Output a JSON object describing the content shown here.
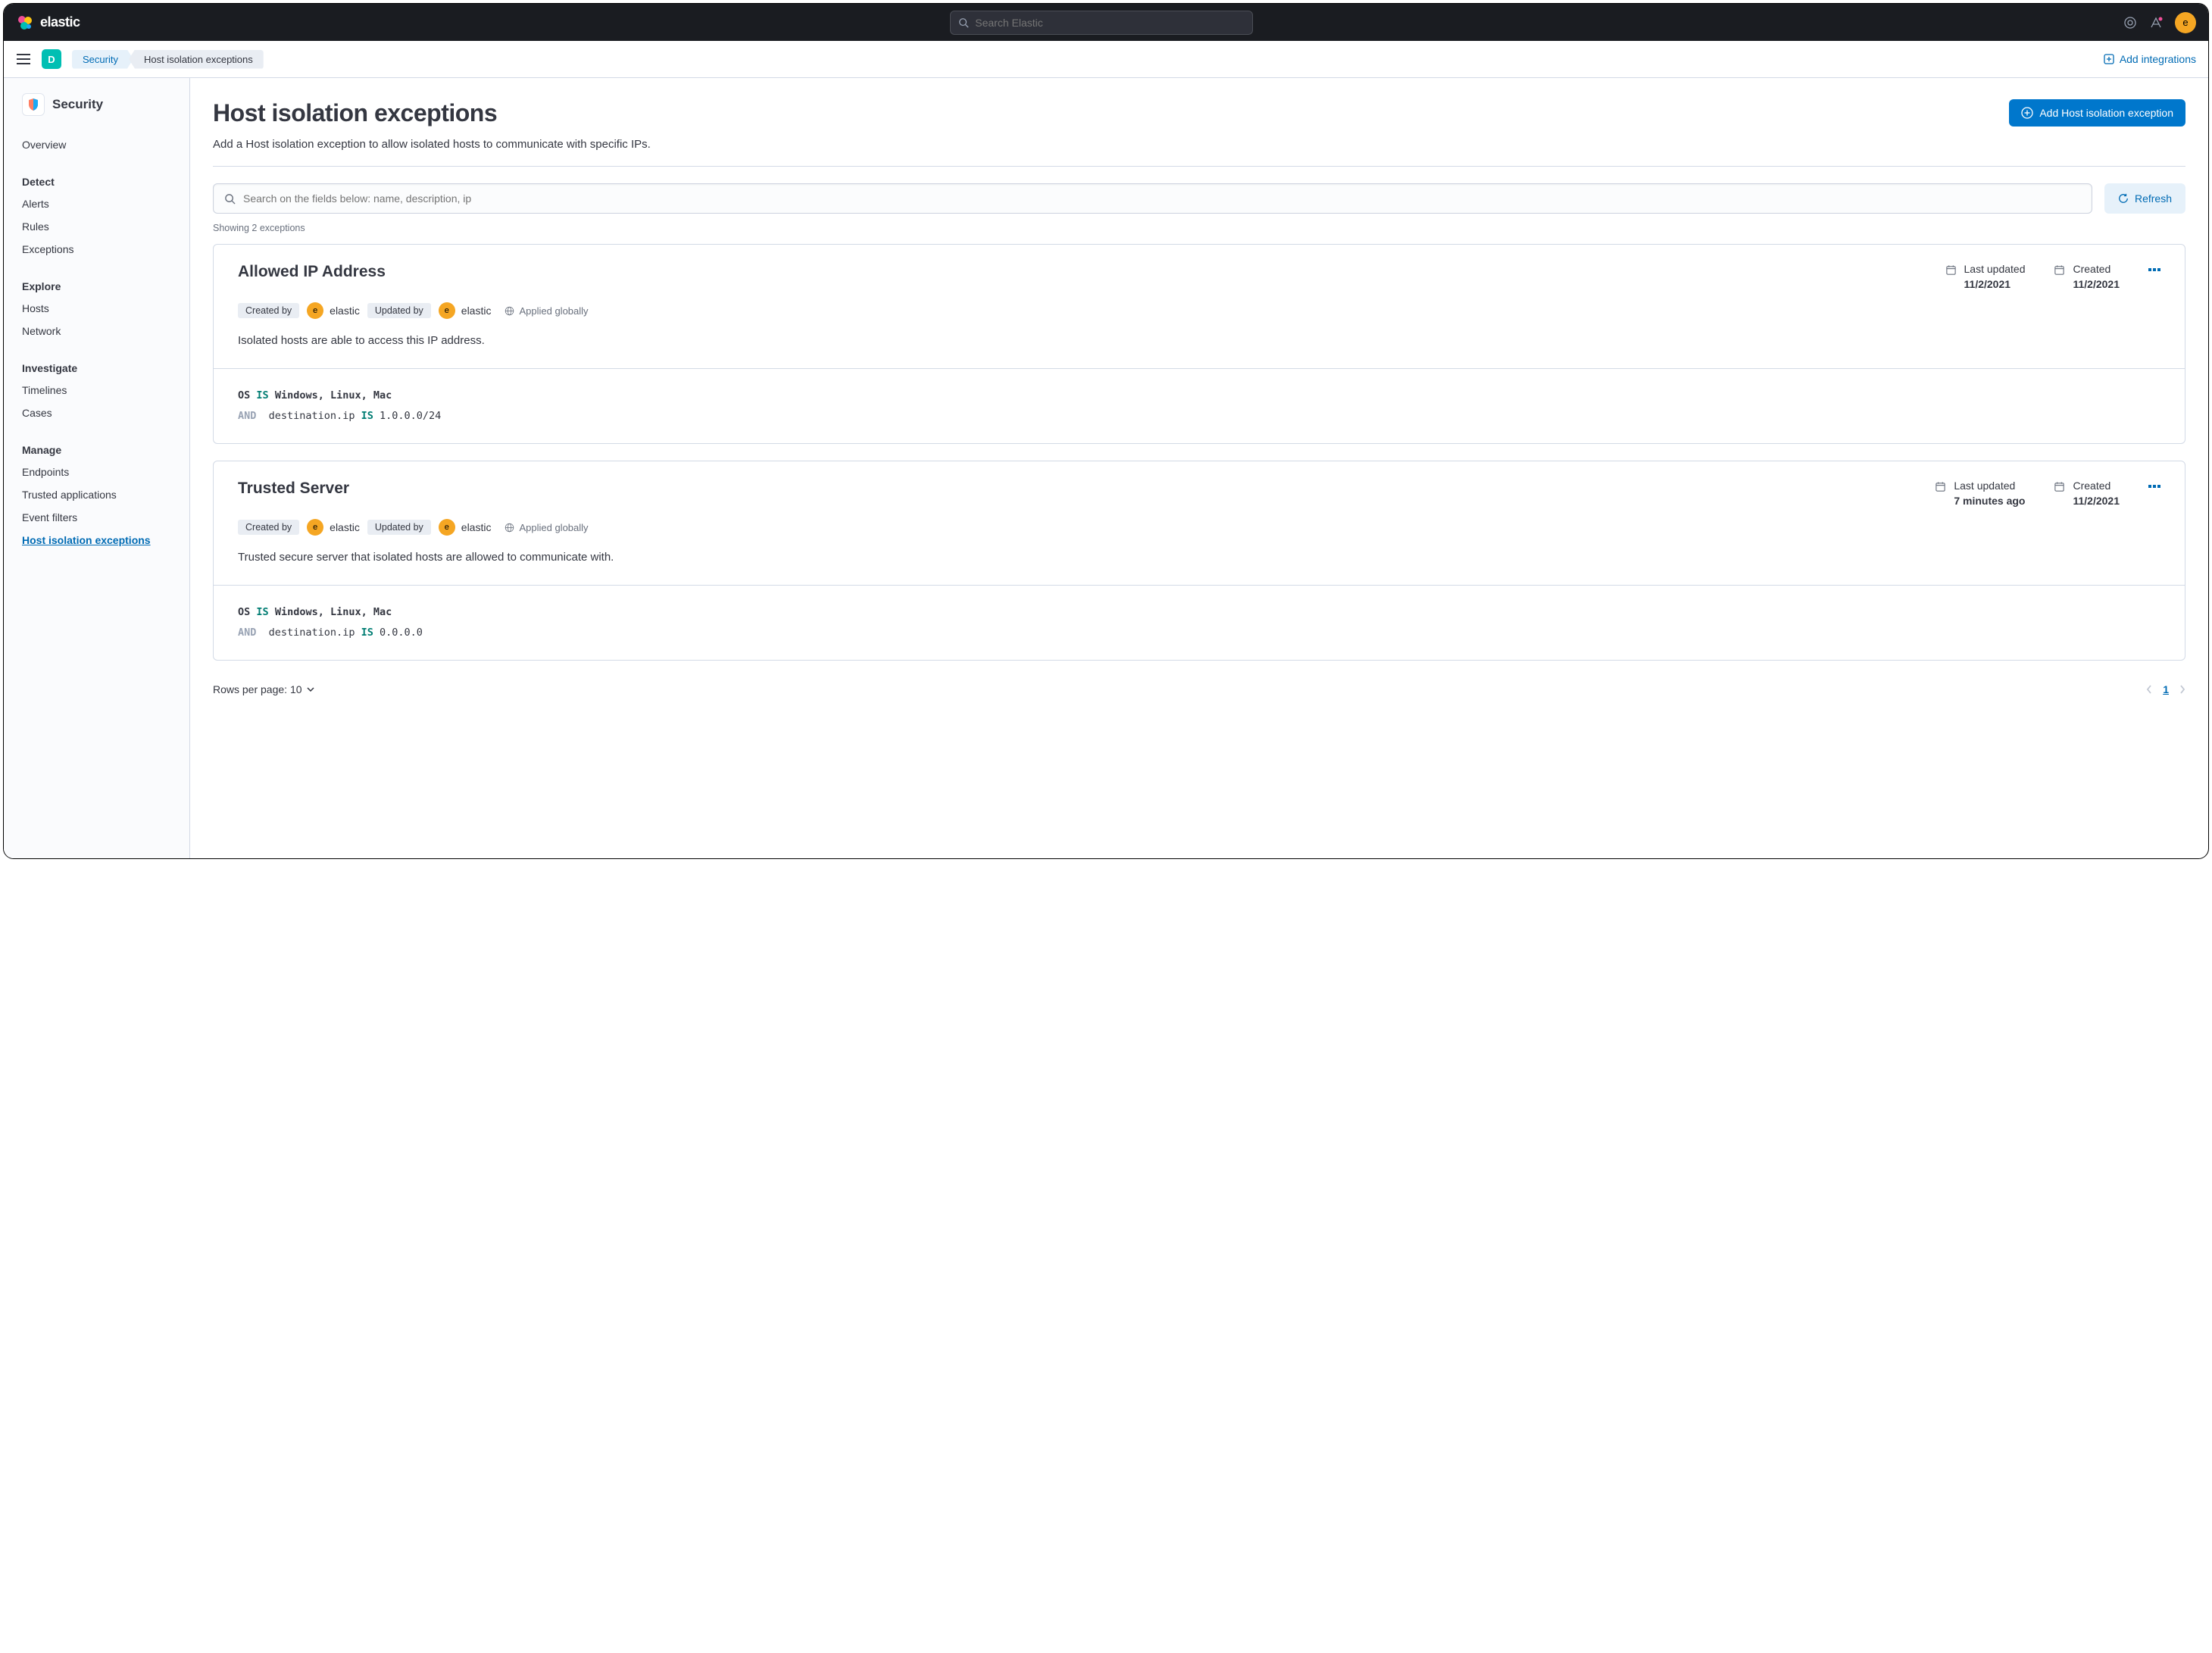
{
  "header": {
    "brand": "elastic",
    "search_placeholder": "Search Elastic",
    "avatar_initial": "e"
  },
  "subheader": {
    "space_initial": "D",
    "crumb1": "Security",
    "crumb2": "Host isolation exceptions",
    "add_integrations": "Add integrations"
  },
  "sidebar": {
    "title": "Security",
    "overview": "Overview",
    "groups": {
      "detect": {
        "title": "Detect",
        "items": [
          "Alerts",
          "Rules",
          "Exceptions"
        ]
      },
      "explore": {
        "title": "Explore",
        "items": [
          "Hosts",
          "Network"
        ]
      },
      "investigate": {
        "title": "Investigate",
        "items": [
          "Timelines",
          "Cases"
        ]
      },
      "manage": {
        "title": "Manage",
        "items": [
          "Endpoints",
          "Trusted applications",
          "Event filters",
          "Host isolation exceptions"
        ]
      }
    }
  },
  "page": {
    "title": "Host isolation exceptions",
    "desc": "Add a Host isolation exception to allow isolated hosts to communicate with specific IPs.",
    "add_button": "Add Host isolation exception",
    "search_placeholder": "Search on the fields below: name, description, ip",
    "refresh": "Refresh",
    "showing": "Showing 2 exceptions",
    "rows_per_page": "Rows per page: 10",
    "page_num": "1"
  },
  "labels": {
    "created_by": "Created by",
    "updated_by": "Updated by",
    "applied": "Applied globally",
    "last_updated": "Last updated",
    "created": "Created"
  },
  "cards": [
    {
      "title": "Allowed IP Address",
      "created_by_user": "elastic",
      "updated_by_user": "elastic",
      "last_updated": "11/2/2021",
      "created": "11/2/2021",
      "desc": "Isolated hosts are able to access this IP address.",
      "code": {
        "line1_field": "OS",
        "line1_op": "IS",
        "line1_val": "Windows, Linux, Mac",
        "line2_and": "AND",
        "line2_field": "destination.ip",
        "line2_op": "IS",
        "line2_val": "1.0.0.0/24"
      }
    },
    {
      "title": "Trusted Server",
      "created_by_user": "elastic",
      "updated_by_user": "elastic",
      "last_updated": "7 minutes ago",
      "created": "11/2/2021",
      "desc": "Trusted secure server that isolated hosts are allowed to communicate with.",
      "code": {
        "line1_field": "OS",
        "line1_op": "IS",
        "line1_val": "Windows, Linux, Mac",
        "line2_and": "AND",
        "line2_field": "destination.ip",
        "line2_op": "IS",
        "line2_val": "0.0.0.0"
      }
    }
  ]
}
